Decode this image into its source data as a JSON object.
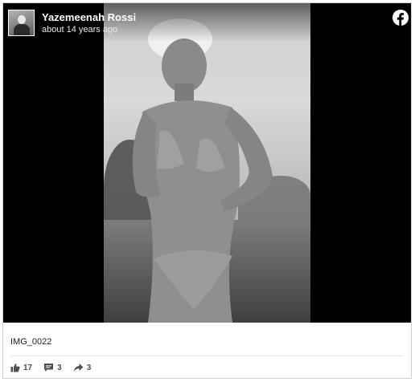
{
  "post": {
    "author": "Yazemeenah Rossi",
    "timestamp": "about 14 years ago",
    "caption": "IMG_0022",
    "stats": {
      "likes": "17",
      "comments": "3",
      "shares": "3"
    }
  },
  "icons": {
    "brand": "facebook-icon",
    "like": "thumbs-up-icon",
    "comment": "speech-bubble-icon",
    "share": "share-arrow-icon"
  },
  "colors": {
    "brand": "#1877f2",
    "stat_text": "#4b4f56",
    "media_background": "#000000"
  }
}
